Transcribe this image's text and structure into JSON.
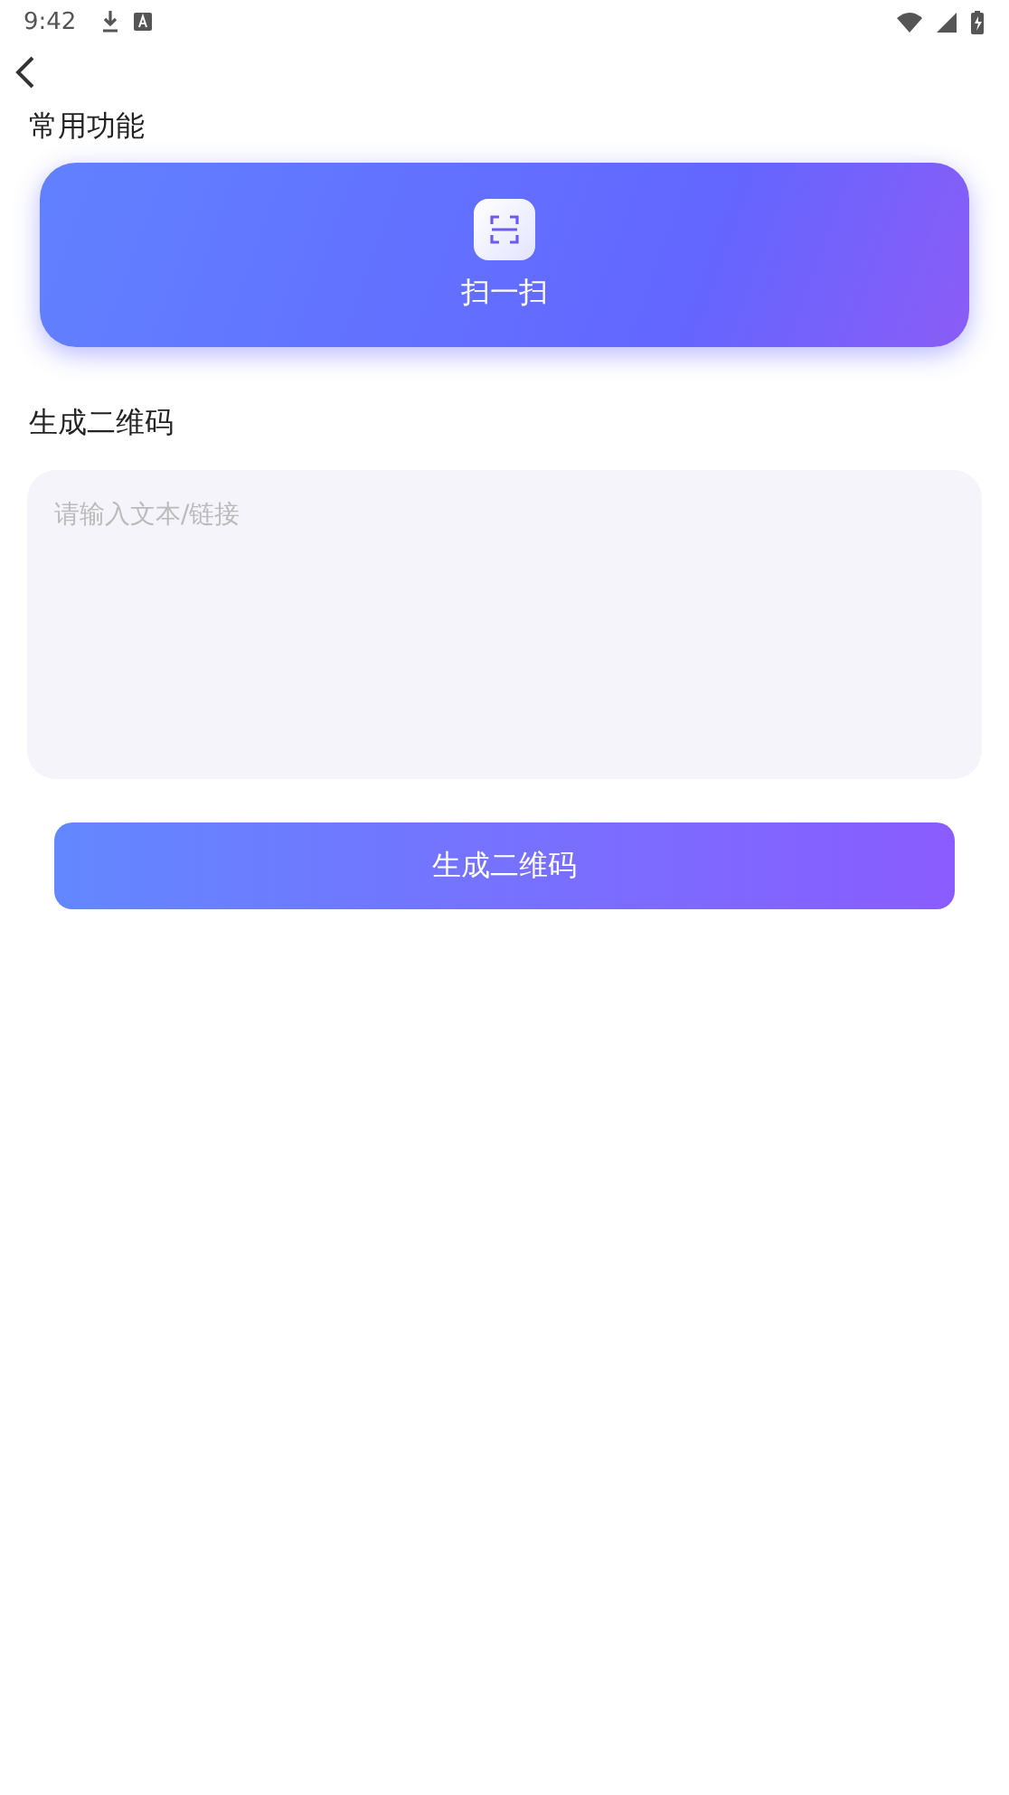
{
  "status_bar": {
    "time": "9:42"
  },
  "sections": [
    {
      "title": "常用功能"
    },
    {
      "title": "生成二维码"
    }
  ],
  "scan_card": {
    "label": "扫一扫"
  },
  "text_input": {
    "placeholder": "请输入文本/链接"
  },
  "generate_button": {
    "label": "生成二维码"
  }
}
